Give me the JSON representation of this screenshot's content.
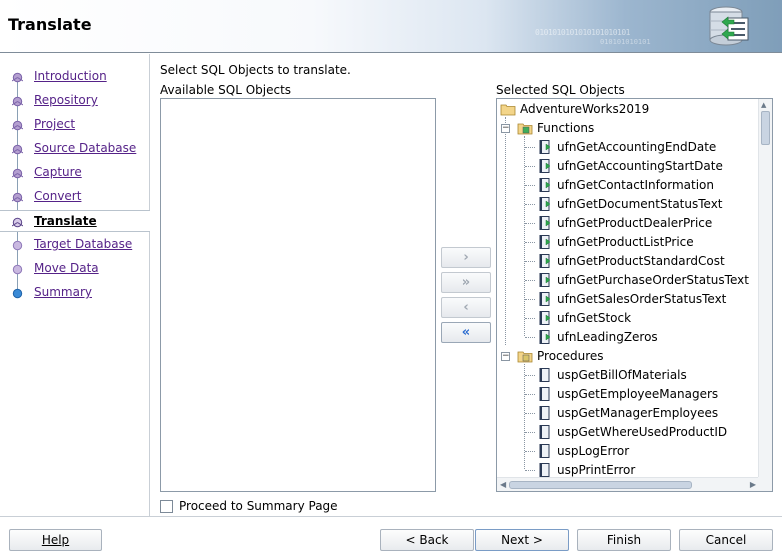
{
  "header": {
    "title": "Translate",
    "binary_decor": "0101010101010101010101",
    "binary_decor2": "010101010101"
  },
  "nav": {
    "items": [
      {
        "label": "Introduction",
        "state": "done"
      },
      {
        "label": "Repository",
        "state": "done"
      },
      {
        "label": "Project",
        "state": "done"
      },
      {
        "label": "Source Database",
        "state": "done"
      },
      {
        "label": "Capture",
        "state": "done"
      },
      {
        "label": "Convert",
        "state": "done"
      },
      {
        "label": "Translate",
        "state": "active"
      },
      {
        "label": "Target Database",
        "state": "todo"
      },
      {
        "label": "Move Data",
        "state": "todo"
      },
      {
        "label": "Summary",
        "state": "last"
      }
    ]
  },
  "main": {
    "instruction": "Select SQL Objects to translate.",
    "available_label": "Available SQL Objects",
    "selected_label": "Selected SQL Objects",
    "move_buttons": [
      {
        "glyph": "›",
        "name": "move-selected-right-button",
        "enabled": false
      },
      {
        "glyph": "»",
        "name": "move-all-right-button",
        "enabled": false
      },
      {
        "glyph": "‹",
        "name": "move-selected-left-button",
        "enabled": false
      },
      {
        "glyph": "«",
        "name": "move-all-left-button",
        "enabled": true
      }
    ],
    "proceed_checkbox_label": "Proceed to Summary Page"
  },
  "tree": {
    "root": "AdventureWorks2019",
    "functions_label": "Functions",
    "functions": [
      "ufnGetAccountingEndDate",
      "ufnGetAccountingStartDate",
      "ufnGetContactInformation",
      "ufnGetDocumentStatusText",
      "ufnGetProductDealerPrice",
      "ufnGetProductListPrice",
      "ufnGetProductStandardCost",
      "ufnGetPurchaseOrderStatusText",
      "ufnGetSalesOrderStatusText",
      "ufnGetStock",
      "ufnLeadingZeros"
    ],
    "procedures_label": "Procedures",
    "procedures": [
      "uspGetBillOfMaterials",
      "uspGetEmployeeManagers",
      "uspGetManagerEmployees",
      "uspGetWhereUsedProductID",
      "uspLogError",
      "uspPrintError"
    ]
  },
  "footer": {
    "help": "Help",
    "back": "< Back",
    "next": "Next >",
    "finish": "Finish",
    "cancel": "Cancel"
  },
  "colors": {
    "link": "#552288",
    "accent": "#2c6cd0",
    "border": "#8c9aa8"
  }
}
